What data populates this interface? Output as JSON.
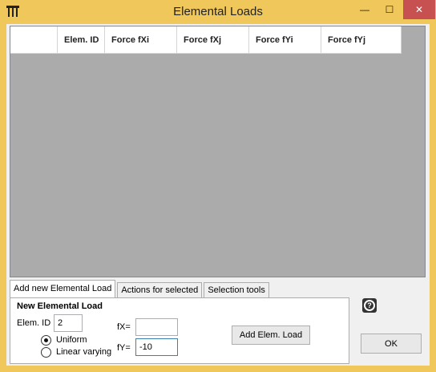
{
  "window": {
    "title": "Elemental Loads",
    "app_icon": "window-icon",
    "minimize_glyph": "—",
    "maximize_glyph": "☐",
    "close_glyph": "✕",
    "frame_color": "#F0C75A",
    "close_color": "#C75050"
  },
  "grid": {
    "columns": [
      "Elem. ID",
      "Force fXi",
      "Force fXj",
      "Force fYi",
      "Force fYj"
    ],
    "rows": [],
    "background": "#ABABAB"
  },
  "tabs": [
    {
      "label": "Add new Elemental Load",
      "active": true
    },
    {
      "label": "Actions for selected",
      "active": false
    },
    {
      "label": "Selection tools",
      "active": false
    }
  ],
  "panel": {
    "section_title": "New Elemental Load",
    "elem_id_label": "Elem. ID",
    "elem_id_value": "2",
    "load_type": {
      "options": [
        "Uniform",
        "Linear varying"
      ],
      "selected": "Uniform"
    },
    "fx_label": "fX=",
    "fx_value": "",
    "fy_label": "fY=",
    "fy_value": "-10",
    "add_button_label": "Add Elem. Load"
  },
  "help_icon": "help-icon",
  "ok_button_label": "OK"
}
